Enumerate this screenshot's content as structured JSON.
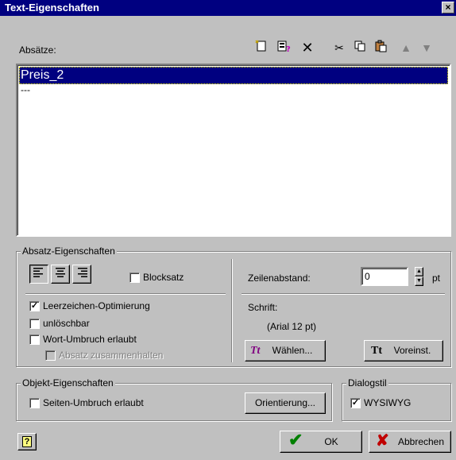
{
  "window": {
    "title": "Text-Eigenschaften",
    "close_glyph": "×"
  },
  "paragraphs": {
    "label": "Absätze:",
    "items": [
      "Preis_2",
      "---"
    ],
    "toolbar_icons": [
      "new-icon",
      "paragraph-help-icon",
      "delete-icon",
      "cut-icon",
      "copy-icon",
      "paste-icon",
      "move-up-icon",
      "move-down-icon"
    ]
  },
  "absatz": {
    "title": "Absatz-Eigenschaften",
    "blocksatz_label": "Blocksatz",
    "zeilenabstand_label": "Zeilenabstand:",
    "zeilenabstand_value": "0",
    "zeilenabstand_unit": "pt",
    "schrift_label": "Schrift:",
    "schrift_value": "(Arial 12 pt)",
    "waehlen_label": "Wählen...",
    "voreinst_label": "Voreinst.",
    "leerzeichen_label": "Leerzeichen-Optimierung",
    "leerzeichen_checked": true,
    "unloeschbar_label": "unlöschbar",
    "unloeschbar_checked": false,
    "wortumbruch_label": "Wort-Umbruch erlaubt",
    "wortumbruch_checked": false,
    "zusammen_label": "Absatz zusammenhalten",
    "zusammen_checked": false,
    "blocksatz_checked": false
  },
  "objekt": {
    "title": "Objekt-Eigenschaften",
    "seitenumbruch_label": "Seiten-Umbruch erlaubt",
    "seitenumbruch_checked": false,
    "orientierung_label": "Orientierung..."
  },
  "dialogstil": {
    "title": "Dialogstil",
    "wysiwyg_label": "WYSIWYG",
    "wysiwyg_checked": true
  },
  "footer": {
    "help_glyph": "?",
    "ok_label": "OK",
    "cancel_label": "Abbrechen"
  },
  "colors": {
    "face": "#c0c0c0",
    "title_bar": "#000080",
    "selection": "#000080",
    "ok_check": "#008000",
    "cancel_x": "#c00000",
    "tt_italic": "#800080"
  }
}
